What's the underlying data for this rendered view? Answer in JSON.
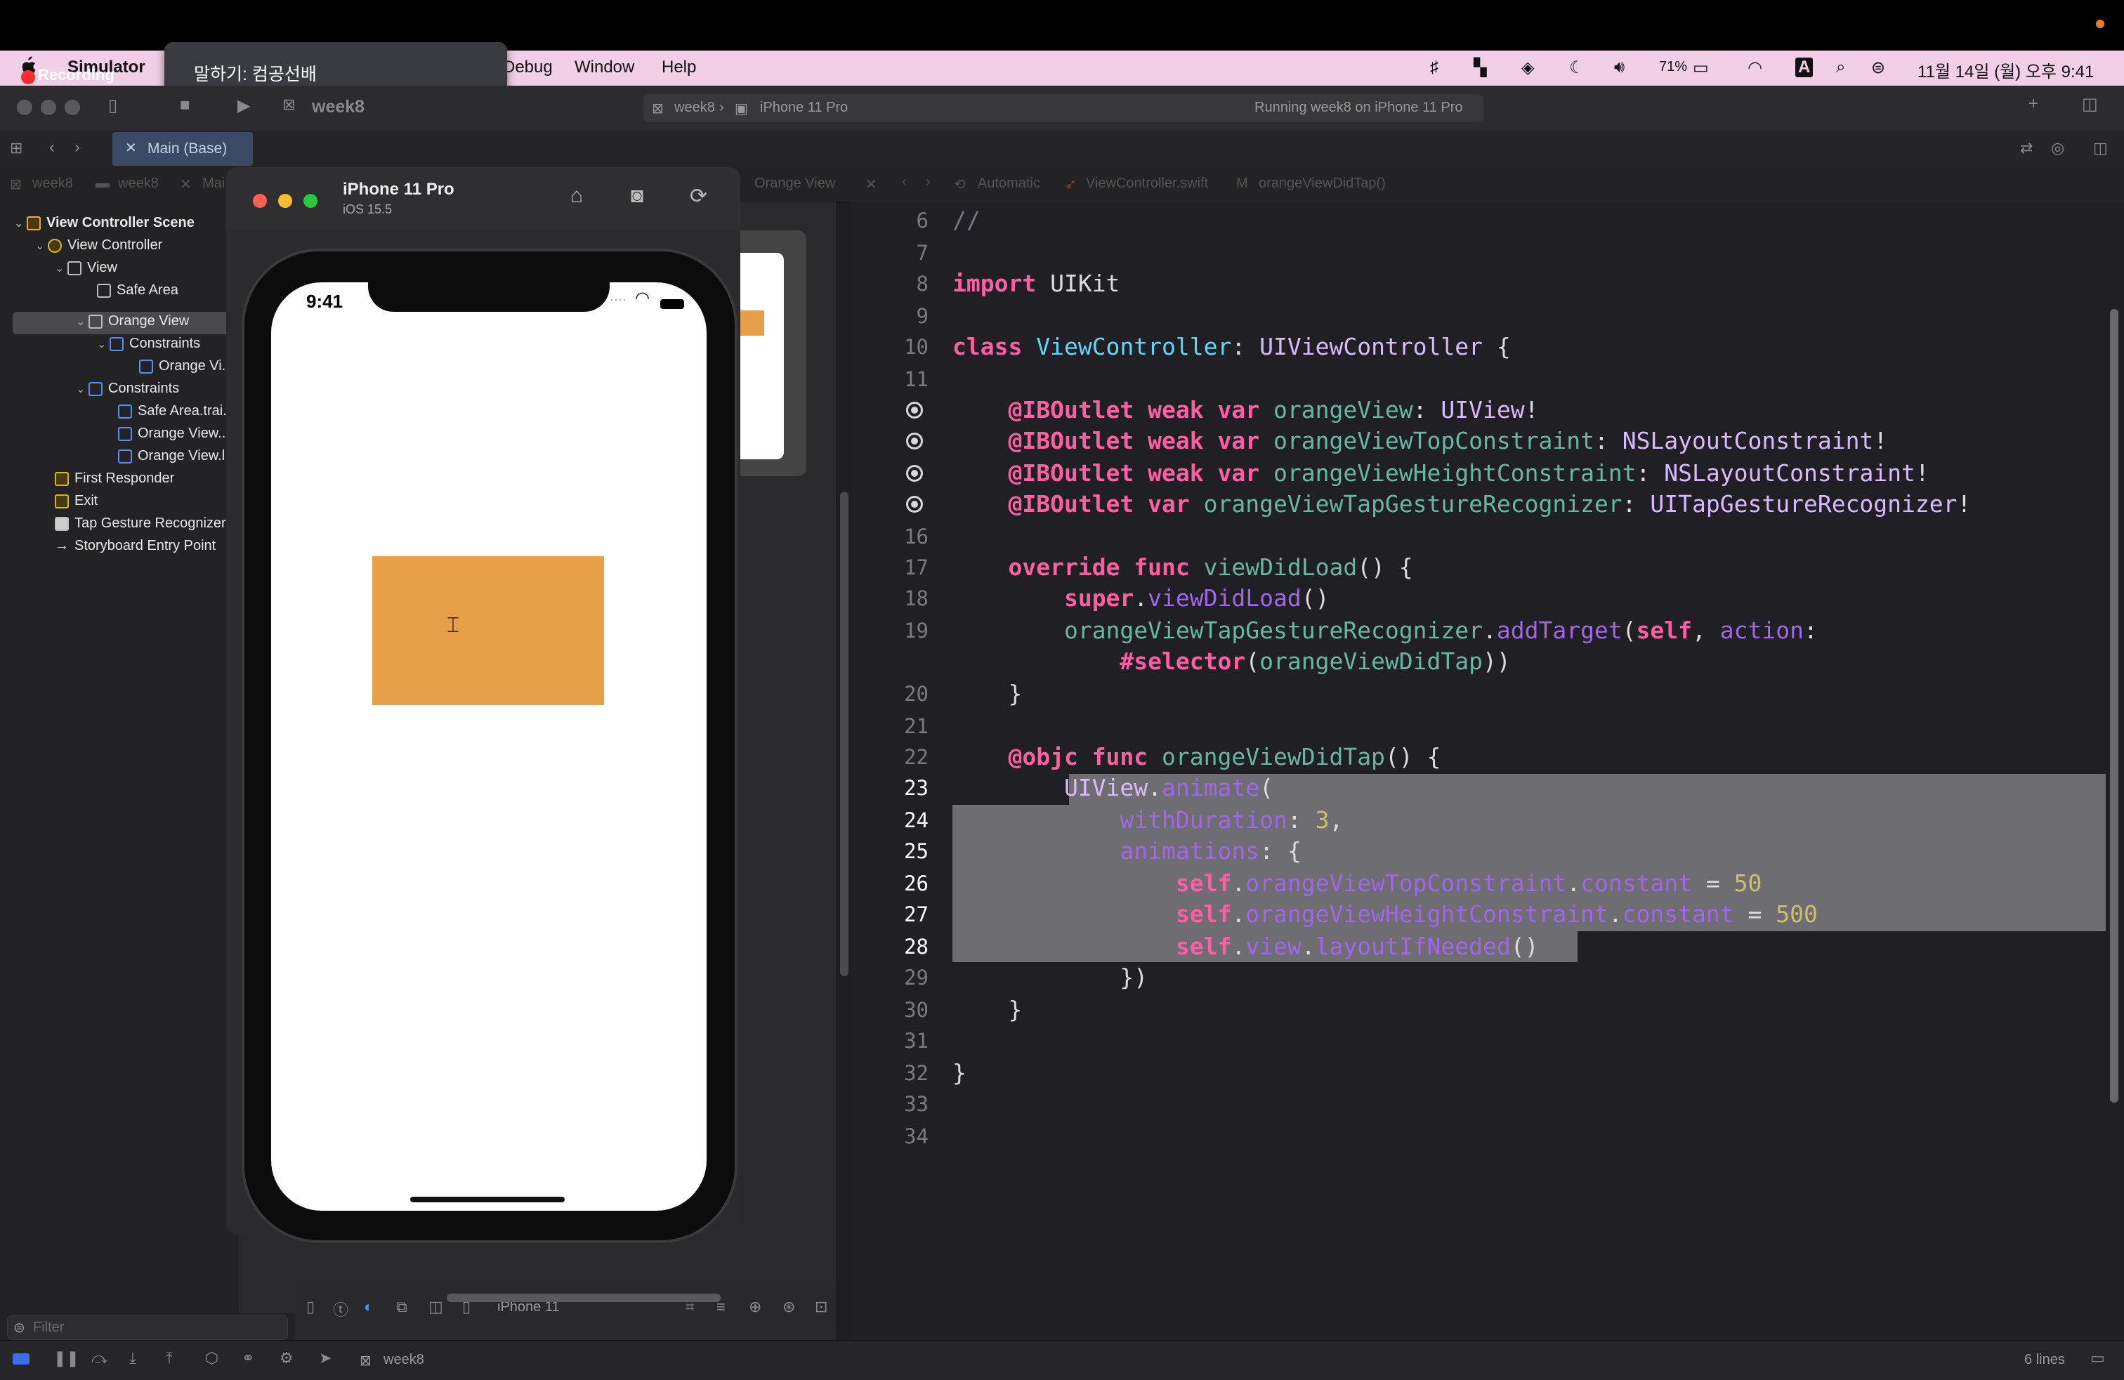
{
  "menubar": {
    "app_name": "Simulator",
    "items": [
      "Debug",
      "Window",
      "Help"
    ],
    "battery": "71%",
    "datetime": "11월 14일 (월) 오후 9:41"
  },
  "recording": {
    "label": "Recording",
    "speak_text": "말하기: 컴공선배"
  },
  "toolbar": {
    "scheme": "week8",
    "target_project": "week8",
    "target_device": "iPhone 11 Pro",
    "activity_status": "Running week8 on iPhone 11 Pro"
  },
  "tab": {
    "label": "Main (Base)"
  },
  "jumpbar": {
    "left": [
      "week8",
      "week8",
      "Mai"
    ],
    "right_view": "Orange View",
    "automatic": "Automatic",
    "file": "ViewController.swift",
    "method": "orangeViewDidTap()"
  },
  "navigator": {
    "items": [
      "View Controller Scene",
      "View Controller",
      "View",
      "Safe Area",
      "Orange View",
      "Constraints",
      "Orange Vi...",
      "Constraints",
      "Safe Area.trai...",
      "Orange View...",
      "Orange View.l...",
      "First Responder",
      "Exit",
      "Tap Gesture Recognizer",
      "Storyboard Entry Point"
    ],
    "filter_placeholder": "Filter"
  },
  "simulator": {
    "device_name": "iPhone 11 Pro",
    "os_version": "iOS 15.5",
    "time": "9:41"
  },
  "canvas": {
    "device_label": "iPhone 11"
  },
  "editor": {
    "line_numbers": [
      "6",
      "7",
      "8",
      "9",
      "10",
      "11",
      "",
      "",
      "",
      "",
      "16",
      "17",
      "18",
      "19",
      "",
      "20",
      "21",
      "22",
      "23",
      "24",
      "25",
      "26",
      "27",
      "28",
      "29",
      "30",
      "31",
      "32",
      "33",
      "34"
    ],
    "lines_status": "6 lines"
  },
  "debugbar": {
    "scheme": "week8"
  },
  "colors": {
    "menubar": "#f0cfe7",
    "orange_view": "#e89f49",
    "keyword": "#fc5fa3",
    "selection": "#6d6d72"
  }
}
